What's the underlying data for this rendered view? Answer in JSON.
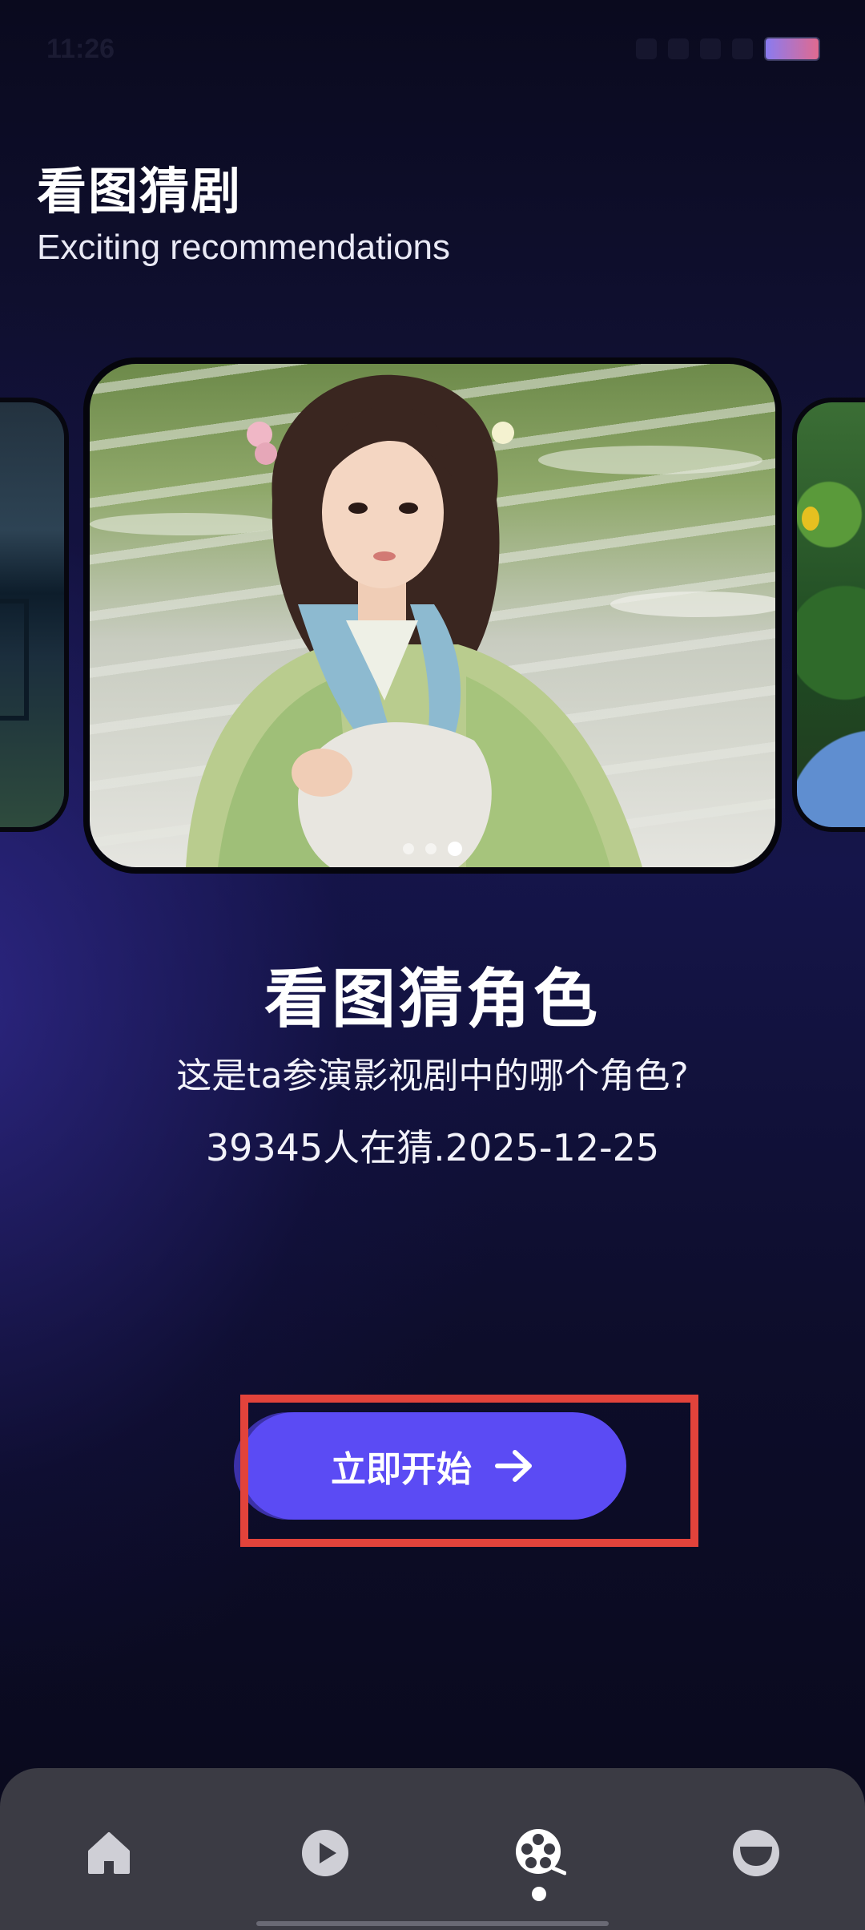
{
  "header": {
    "title": "看图猜剧",
    "subtitle": "Exciting recommendations"
  },
  "status_bar": {
    "time": "11:26"
  },
  "carousel": {
    "page_count": 3,
    "active_index": 2
  },
  "game": {
    "title": "看图猜角色",
    "question": "这是ta参演影视剧中的哪个角色?",
    "meta": "39345人在猜.2025-12-25"
  },
  "start_button": {
    "label": "立即开始",
    "icon": "arrow-right-icon"
  },
  "bottom_nav": {
    "items": [
      {
        "icon": "home-icon"
      },
      {
        "icon": "play-icon"
      },
      {
        "icon": "film-reel-icon",
        "active": true
      },
      {
        "icon": "profile-icon"
      }
    ]
  },
  "colors": {
    "accent": "#5b4bf4",
    "highlight": "#e2433b",
    "nav_background": "#3b3b44"
  }
}
